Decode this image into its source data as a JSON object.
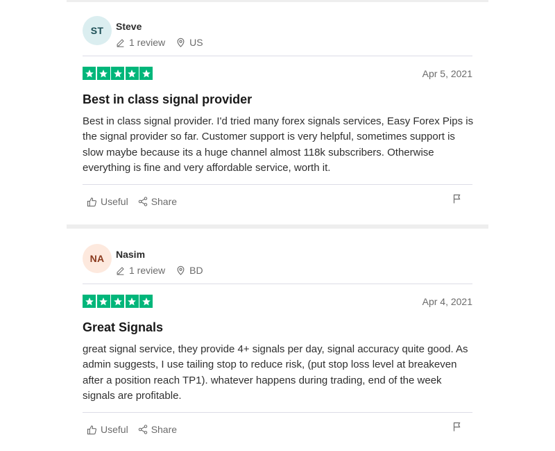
{
  "reviews": [
    {
      "avatar_initials": "ST",
      "avatar_bg": "#dbeef0",
      "avatar_fg": "#1c4f55",
      "name": "Steve",
      "review_count": "1 review",
      "country": "US",
      "rating": 5,
      "date": "Apr 5, 2021",
      "title": "Best in class signal provider",
      "body": "Best in class signal provider. I'd tried many forex signals services, Easy Forex Pips is the signal provider so far. Customer support is very helpful, sometimes support is slow maybe because its a huge channel almost 118k subscribers. Otherwise everything is fine and very affordable service, worth it.",
      "useful_label": "Useful",
      "share_label": "Share"
    },
    {
      "avatar_initials": "NA",
      "avatar_bg": "#fde9de",
      "avatar_fg": "#8a3a1e",
      "name": "Nasim",
      "review_count": "1 review",
      "country": "BD",
      "rating": 5,
      "date": "Apr 4, 2021",
      "title": "Great Signals",
      "body": "great signal service, they provide 4+ signals per day, signal accuracy quite good. As admin suggests, I use tailing stop to reduce risk, (put stop loss level at breakeven after a position reach TP1). whatever happens during trading, end of the week signals are profitable.",
      "useful_label": "Useful",
      "share_label": "Share"
    }
  ],
  "colors": {
    "star_green": "#00b67a",
    "divider": "#eeeeee"
  }
}
